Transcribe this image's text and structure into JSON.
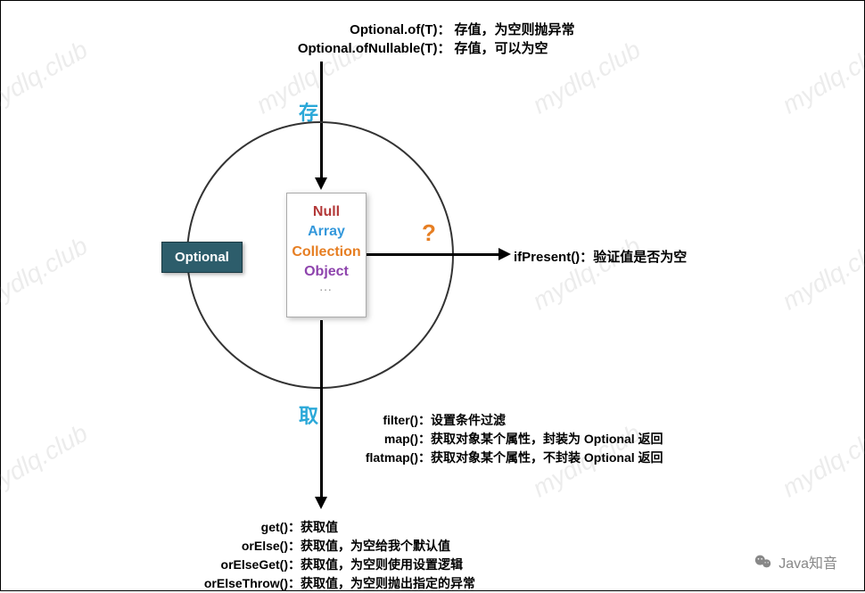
{
  "top": {
    "items": [
      {
        "method": "Optional.of(T)：",
        "desc": "存值，为空则抛异常"
      },
      {
        "method": "Optional.ofNullable(T)：",
        "desc": "存值，可以为空"
      }
    ]
  },
  "circle_label": "Optional",
  "store_label": "存",
  "take_label": "取",
  "question_mark": "?",
  "content_box": {
    "null": "Null",
    "array": "Array",
    "collection": "Collection",
    "object": "Object",
    "dots": "..."
  },
  "right": {
    "method": "ifPresent()：",
    "desc": "验证值是否为空"
  },
  "middle": {
    "items": [
      {
        "method": "filter()：",
        "desc": "设置条件过滤"
      },
      {
        "method": "map()：",
        "desc": "获取对象某个属性，封装为 Optional 返回"
      },
      {
        "method": "flatmap()：",
        "desc": "获取对象某个属性，不封装 Optional 返回"
      }
    ]
  },
  "bottom": {
    "items": [
      {
        "method": "get()：",
        "desc": "获取值"
      },
      {
        "method": "orElse()：",
        "desc": "获取值，为空给我个默认值"
      },
      {
        "method": "orElseGet()：",
        "desc": "获取值，为空则使用设置逻辑"
      },
      {
        "method": "orElseThrow()：",
        "desc": "获取值，为空则抛出指定的异常"
      }
    ]
  },
  "watermark": "mydlq.club",
  "brand": "Java知音"
}
